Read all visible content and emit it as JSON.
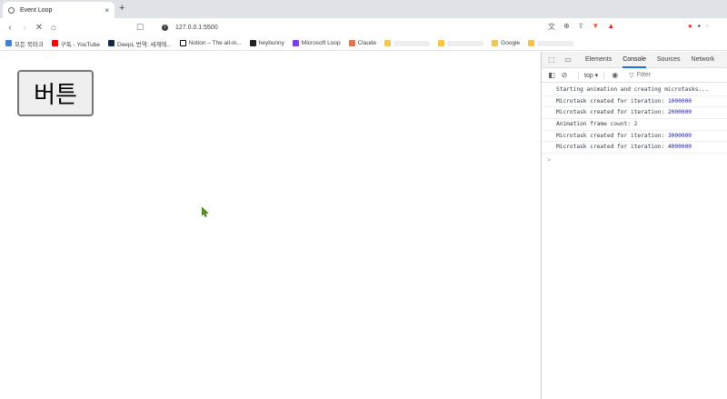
{
  "tab": {
    "title": "Event Loop",
    "close": "×",
    "new_tab": "+"
  },
  "nav": {
    "back": "‹",
    "forward": "›",
    "reload": "✕",
    "home": "⌂"
  },
  "omnibox": {
    "url": "127.0.0.1:5500"
  },
  "bookmarks": [
    {
      "label": "모든 북마크",
      "icon": "apps-icon"
    },
    {
      "label": "구독 - YouTube",
      "icon": "youtube-icon"
    },
    {
      "label": "DeepL 번역: 세계에...",
      "icon": "deepl-icon"
    },
    {
      "label": "Notion – The all-in...",
      "icon": "notion-icon"
    },
    {
      "label": "heybunny",
      "icon": "heybunny-icon"
    },
    {
      "label": "Microsoft Loop",
      "icon": "loop-icon"
    },
    {
      "label": "Claude",
      "icon": "claude-icon"
    },
    {
      "label": "Google",
      "icon": "folder-icon"
    }
  ],
  "page": {
    "button_label": "버튼"
  },
  "devtools": {
    "tabs": [
      "Elements",
      "Console",
      "Sources",
      "Network"
    ],
    "active_tab": "Console",
    "context": "top ▾",
    "filter_placeholder": "Filter",
    "logs": [
      {
        "text": "Starting animation and creating microtasks...",
        "num": ""
      },
      {
        "text": "Microtask created for iteration: ",
        "num": "1000000"
      },
      {
        "text": "Microtask created for iteration: ",
        "num": "2000000"
      },
      {
        "text": "Animation frame count: 2",
        "num": ""
      },
      {
        "text": "Microtask created for iteration: ",
        "num": "3000000"
      },
      {
        "text": "Microtask created for iteration: ",
        "num": "4000000"
      }
    ],
    "prompt": ">"
  },
  "colors": {
    "accent": "#1a73e8",
    "number": "#1a1aa6",
    "cursor": "#5a9a1a"
  }
}
